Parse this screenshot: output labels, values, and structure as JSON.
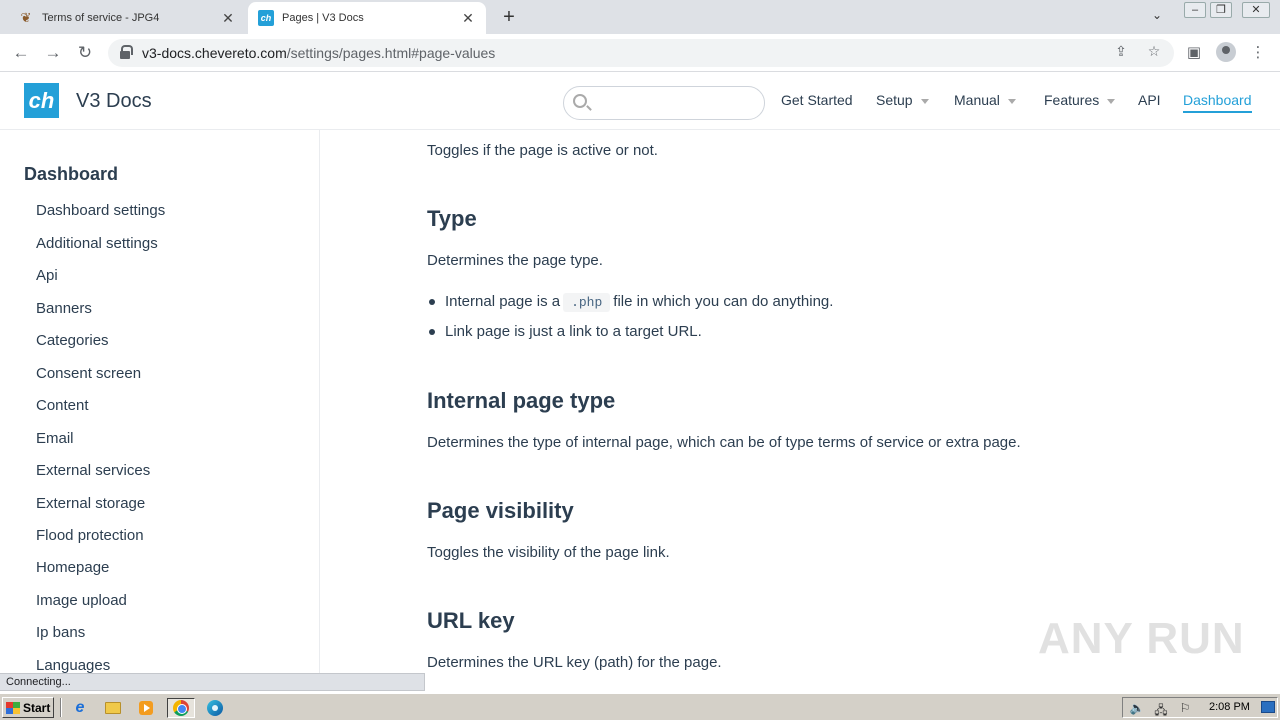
{
  "browser": {
    "tabs": [
      {
        "title": "Terms of service - JPG4",
        "active": false
      },
      {
        "title": "Pages | V3 Docs",
        "active": true
      }
    ],
    "url_host": "v3-docs.chevereto.com",
    "url_path": "/settings/pages.html#page-values",
    "status_text": "Connecting...",
    "icons": {
      "back": "←",
      "forward": "→",
      "reload": "↻",
      "share": "⇪",
      "star": "☆",
      "side_panel": "▣",
      "menu": "⋮",
      "tab_close": "✕",
      "new_tab": "+",
      "tab_list": "⌄",
      "minimize": "–",
      "restore": "❐",
      "close": "✕"
    }
  },
  "site": {
    "logo_text": "ch",
    "name": "V3 Docs",
    "search_placeholder": "",
    "nav": [
      {
        "label": "Get Started",
        "dropdown": false,
        "current": false
      },
      {
        "label": "Setup",
        "dropdown": true,
        "current": false
      },
      {
        "label": "Manual",
        "dropdown": true,
        "current": false
      },
      {
        "label": "Features",
        "dropdown": true,
        "current": false
      },
      {
        "label": "API",
        "dropdown": false,
        "current": false
      },
      {
        "label": "Dashboard",
        "dropdown": false,
        "current": true
      }
    ],
    "accent_color": "#24a0d8",
    "text_color": "#2c3e50"
  },
  "sidebar": {
    "heading": "Dashboard",
    "items": [
      "Dashboard settings",
      "Additional settings",
      "Api",
      "Banners",
      "Categories",
      "Consent screen",
      "Content",
      "Email",
      "External services",
      "External storage",
      "Flood protection",
      "Homepage",
      "Image upload",
      "Ip bans",
      "Languages"
    ]
  },
  "content": {
    "intro": "Toggles if the page is active or not.",
    "type_heading": "Type",
    "type_desc": "Determines the page type.",
    "type_bullet1_pre": "Internal page is a",
    "type_bullet1_code": ".php",
    "type_bullet1_post": "file in which you can do anything.",
    "type_bullet2": "Link page is just a link to a target URL.",
    "internal_heading": "Internal page type",
    "internal_desc": "Determines the type of internal page, which can be of type terms of service or extra page.",
    "visibility_heading": "Page visibility",
    "visibility_desc": "Toggles the visibility of the page link.",
    "urlkey_heading": "URL key",
    "urlkey_desc": "Determines the URL key (path) for the page."
  },
  "watermark": "ANY RUN",
  "taskbar": {
    "start_label": "Start",
    "clock": "2:08 PM",
    "tray_icons": {
      "volume": "🔈",
      "network": "🖧",
      "flag": "⚐"
    }
  }
}
